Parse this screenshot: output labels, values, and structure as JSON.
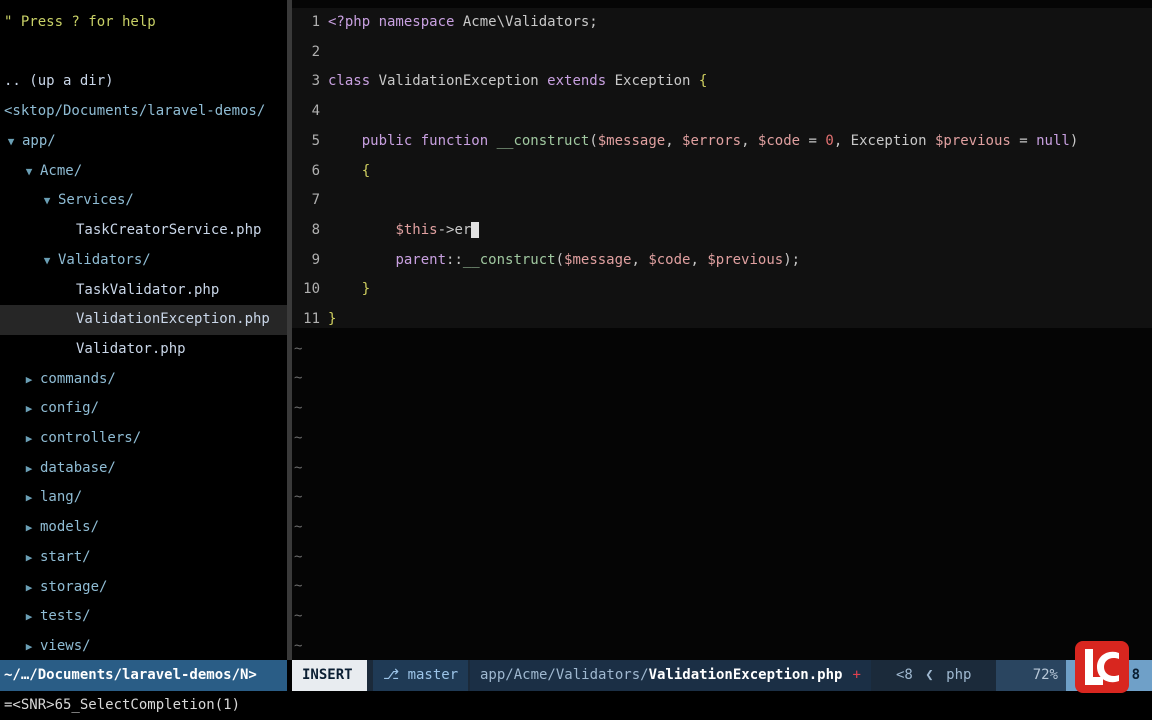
{
  "tree": {
    "help": "\" Press ? for help",
    "updir": ".. (up a dir)",
    "cwd": "<sktop/Documents/laravel-demos/",
    "items": [
      {
        "label": "app/",
        "kind": "dir",
        "open": true,
        "depth": 0
      },
      {
        "label": "Acme/",
        "kind": "dir",
        "open": true,
        "depth": 1
      },
      {
        "label": "Services/",
        "kind": "dir",
        "open": true,
        "depth": 2
      },
      {
        "label": "TaskCreatorService.php",
        "kind": "file",
        "depth": 3
      },
      {
        "label": "Validators/",
        "kind": "dir",
        "open": true,
        "depth": 2
      },
      {
        "label": "TaskValidator.php",
        "kind": "file",
        "depth": 3
      },
      {
        "label": "ValidationException.php",
        "kind": "file",
        "depth": 3,
        "selected": true
      },
      {
        "label": "Validator.php",
        "kind": "file",
        "depth": 3
      },
      {
        "label": "commands/",
        "kind": "dir",
        "open": false,
        "depth": 1
      },
      {
        "label": "config/",
        "kind": "dir",
        "open": false,
        "depth": 1
      },
      {
        "label": "controllers/",
        "kind": "dir",
        "open": false,
        "depth": 1
      },
      {
        "label": "database/",
        "kind": "dir",
        "open": false,
        "depth": 1
      },
      {
        "label": "lang/",
        "kind": "dir",
        "open": false,
        "depth": 1
      },
      {
        "label": "models/",
        "kind": "dir",
        "open": false,
        "depth": 1
      },
      {
        "label": "start/",
        "kind": "dir",
        "open": false,
        "depth": 1
      },
      {
        "label": "storage/",
        "kind": "dir",
        "open": false,
        "depth": 1
      },
      {
        "label": "tests/",
        "kind": "dir",
        "open": false,
        "depth": 1
      },
      {
        "label": "views/",
        "kind": "dir",
        "open": false,
        "depth": 1
      }
    ]
  },
  "editor": {
    "lines": [
      {
        "n": "1",
        "tokens": [
          [
            "kw",
            "<?php "
          ],
          [
            "kw",
            "namespace "
          ],
          [
            "plain",
            "Acme\\Validators;"
          ]
        ]
      },
      {
        "n": "2",
        "tokens": []
      },
      {
        "n": "3",
        "tokens": [
          [
            "kw",
            "class "
          ],
          [
            "plain",
            "ValidationException "
          ],
          [
            "kw",
            "extends "
          ],
          [
            "plain",
            "Exception "
          ],
          [
            "brace",
            "{"
          ]
        ]
      },
      {
        "n": "4",
        "tokens": []
      },
      {
        "n": "5",
        "tokens": [
          [
            "plain",
            "    "
          ],
          [
            "kw",
            "public "
          ],
          [
            "kw",
            "function "
          ],
          [
            "fn",
            "__construct"
          ],
          [
            "plain",
            "("
          ],
          [
            "var",
            "$message"
          ],
          [
            "plain",
            ", "
          ],
          [
            "var",
            "$errors"
          ],
          [
            "plain",
            ", "
          ],
          [
            "var",
            "$code"
          ],
          [
            "plain",
            " = "
          ],
          [
            "num",
            "0"
          ],
          [
            "plain",
            ", "
          ],
          [
            "plain",
            "Exception "
          ],
          [
            "var",
            "$previous"
          ],
          [
            "plain",
            " = "
          ],
          [
            "kw",
            "null"
          ],
          [
            "plain",
            ")"
          ]
        ]
      },
      {
        "n": "6",
        "tokens": [
          [
            "plain",
            "    "
          ],
          [
            "brace",
            "{"
          ]
        ]
      },
      {
        "n": "7",
        "tokens": []
      },
      {
        "n": "8",
        "tokens": [
          [
            "plain",
            "        "
          ],
          [
            "var",
            "$this"
          ],
          [
            "plain",
            "->er"
          ]
        ],
        "cursor": true
      },
      {
        "n": "9",
        "tokens": [
          [
            "plain",
            "        "
          ],
          [
            "kw",
            "parent"
          ],
          [
            "plain",
            "::"
          ],
          [
            "fn",
            "__construct"
          ],
          [
            "plain",
            "("
          ],
          [
            "var",
            "$message"
          ],
          [
            "plain",
            ", "
          ],
          [
            "var",
            "$code"
          ],
          [
            "plain",
            ", "
          ],
          [
            "var",
            "$previous"
          ],
          [
            "plain",
            ");"
          ]
        ]
      },
      {
        "n": "10",
        "tokens": [
          [
            "plain",
            "    "
          ],
          [
            "brace",
            "}"
          ]
        ]
      },
      {
        "n": "11",
        "tokens": [
          [
            "brace",
            "}"
          ]
        ]
      }
    ],
    "tilde_count": 11,
    "tilde": "~"
  },
  "status": {
    "left": "~/…/Documents/laravel-demos/N>",
    "mode": "INSERT",
    "branch_icon": "⎇",
    "branch": "master",
    "path_prefix": "app/Acme/Validators/",
    "filename": "ValidationException.php",
    "modified": "+",
    "enc": "<8",
    "filetype_sep": "❮",
    "filetype": "php",
    "percent": "72%",
    "position": "8"
  },
  "cmdline": "=<SNR>65_SelectCompletion(1)",
  "colors": {
    "status_left_bg": "#2a5d86",
    "mode_bg": "#e8ecf0",
    "logo_red": "#d8261f"
  }
}
